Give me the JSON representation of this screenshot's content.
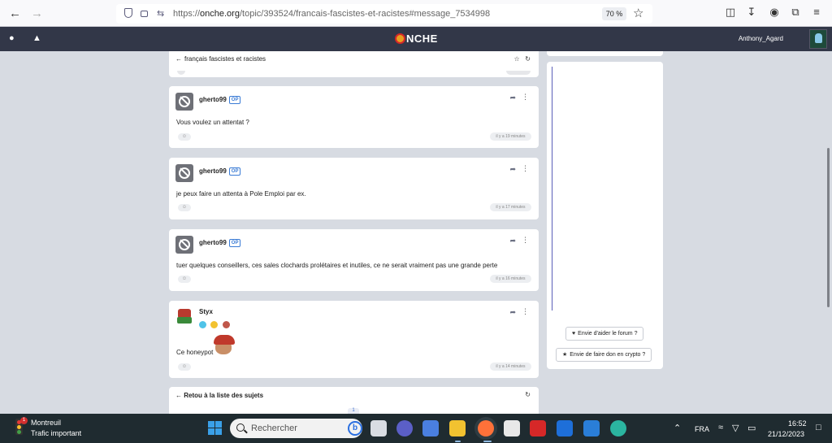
{
  "browser": {
    "url_prefix": "https://",
    "url_host": "onche.org",
    "url_path": "/topic/393524/francais-fascistes-et-racistes#message_7534998",
    "zoom": "70 %"
  },
  "site": {
    "logo": "NCHE",
    "username": "Anthony_Agard"
  },
  "topic": {
    "title": "français fascistes et racistes"
  },
  "posts": [
    {
      "author": "gherto99",
      "op": "OP",
      "text": "Vous voulez un attentat ?",
      "time": "il y a 19 minutes"
    },
    {
      "author": "gherto99",
      "op": "OP",
      "text": "je peux faire un attenta à Pole Emploi par ex.",
      "time": "il y a 17 minutes"
    },
    {
      "author": "gherto99",
      "op": "OP",
      "text": "tuer quelques conseillers, ces sales clochards prolétaires et inutiles, ce ne serait vraiment pas une grande perte",
      "time": "il y a 16 minutes"
    },
    {
      "author": "Styx",
      "op": "",
      "text": "Ce honeypot",
      "time": "il y a 14 minutes"
    }
  ],
  "footer": {
    "back_label": "Retou à la liste des sujets",
    "page": "1"
  },
  "sidebar": {
    "help_button": "Envie d'aider le forum ?",
    "donate_button": "Envie de faire don en crypto ?"
  },
  "taskbar": {
    "weather_title": "Montreuil",
    "weather_sub": "Trafic important",
    "weather_badge": "1",
    "search_placeholder": "Rechercher",
    "lang": "FRA",
    "time": "16:52",
    "date": "21/12/2023"
  },
  "colors": {
    "header_bg": "#323748",
    "accent": "#3a7bd5",
    "taskbar_bg": "#1f2b30"
  }
}
